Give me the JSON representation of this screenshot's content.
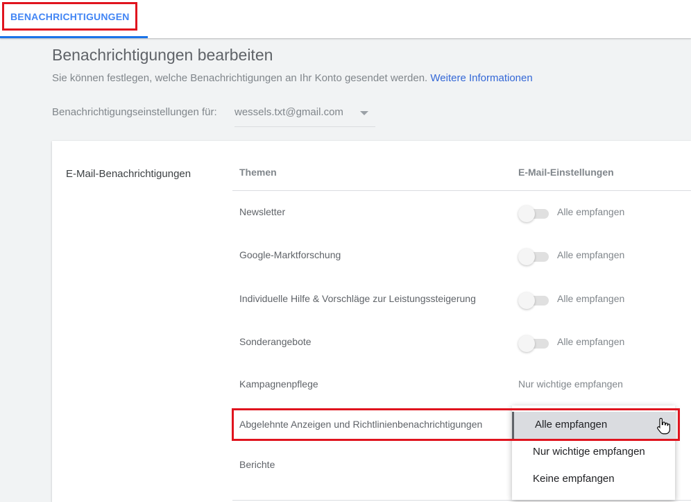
{
  "tabs": {
    "active_label": "BENACHRICHTIGUNGEN"
  },
  "header": {
    "title": "Benachrichtigungen bearbeiten",
    "description": "Sie können festlegen, welche Benachrichtigungen an Ihr Konto gesendet werden.",
    "more_link": "Weitere Informationen",
    "settings_for_label": "Benachrichtigungseinstellungen für:",
    "account": "wessels.txt@gmail.com"
  },
  "card": {
    "section_label": "E-Mail-Benachrichtigungen",
    "col_topics": "Themen",
    "col_email": "E-Mail-Einstellungen",
    "rows": [
      {
        "label": "Newsletter",
        "value": "Alle empfangen",
        "toggle_on": false
      },
      {
        "label": "Google-Marktforschung",
        "value": "Alle empfangen",
        "toggle_on": false
      },
      {
        "label": "Individuelle Hilfe & Vorschläge zur Leistungssteigerung",
        "value": "Alle empfangen",
        "toggle_on": false
      },
      {
        "label": "Sonderangebote",
        "value": "Alle empfangen",
        "toggle_on": false
      },
      {
        "label": "Kampagnenpflege",
        "value": "Nur wichtige empfangen"
      },
      {
        "label": "Abgelehnte Anzeigen und Richtlinienbenachrichtigungen"
      },
      {
        "label": "Berichte"
      }
    ]
  },
  "dropdown": {
    "options": [
      "Alle empfangen",
      "Nur wichtige empfangen",
      "Keine empfangen"
    ],
    "selected": "Alle empfangen"
  },
  "colors": {
    "accent": "#1a73e8",
    "link": "#3367d6",
    "highlight": "#e0141e"
  }
}
